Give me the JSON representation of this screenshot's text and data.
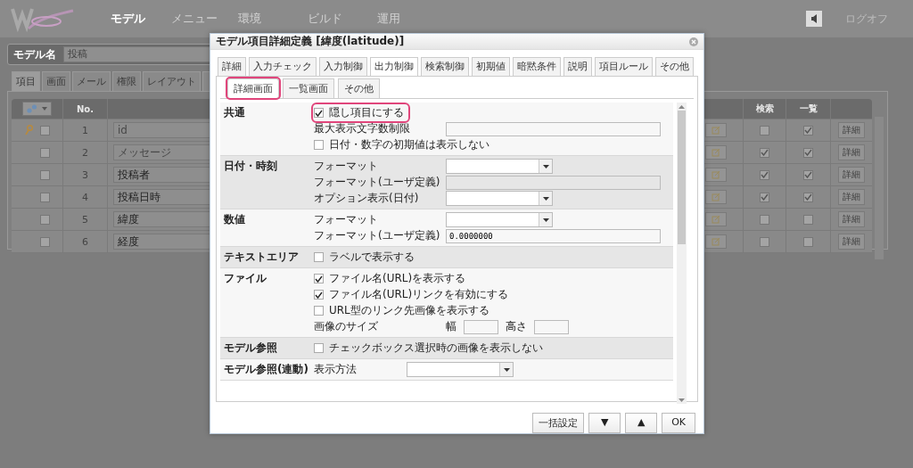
{
  "nav": [
    {
      "label": "モデル",
      "selected": true
    },
    {
      "label": "メニュー",
      "selected": false
    },
    {
      "label": "環境",
      "selected": false
    },
    {
      "label": "ビルド",
      "selected": false
    },
    {
      "label": "運用",
      "selected": false
    }
  ],
  "logoff": "ログオフ",
  "model_name": {
    "label": "モデル名",
    "value": "投稿"
  },
  "page_tabs": [
    {
      "label": "項目",
      "selected": true
    },
    {
      "label": "画面",
      "selected": false
    },
    {
      "label": "メール",
      "selected": false
    },
    {
      "label": "権限",
      "selected": false
    },
    {
      "label": "レイアウト",
      "selected": false
    }
  ],
  "table": {
    "columns": [
      {
        "label": "No."
      },
      {
        "label": "検索"
      },
      {
        "label": "一覧"
      }
    ],
    "rows": [
      {
        "key": true,
        "checked": false,
        "no": "1",
        "name": "id",
        "disabled": true,
        "search": false,
        "list": true,
        "detail": "詳細"
      },
      {
        "key": false,
        "checked": false,
        "no": "2",
        "name": "メッセージ",
        "disabled": true,
        "search": true,
        "list": true,
        "detail": "詳細"
      },
      {
        "key": false,
        "checked": false,
        "no": "3",
        "name": "投稿者",
        "disabled": false,
        "search": true,
        "list": true,
        "detail": "詳細"
      },
      {
        "key": false,
        "checked": false,
        "no": "4",
        "name": "投稿日時",
        "disabled": false,
        "search": true,
        "list": true,
        "detail": "詳細"
      },
      {
        "key": false,
        "checked": false,
        "no": "5",
        "name": "緯度",
        "disabled": false,
        "search": false,
        "list": false,
        "detail": "詳細"
      },
      {
        "key": false,
        "checked": false,
        "no": "6",
        "name": "経度",
        "disabled": false,
        "search": false,
        "list": false,
        "detail": "詳細"
      }
    ]
  },
  "dialog": {
    "title": "モデル項目詳細定義 [緯度(latitude)]",
    "tabs": [
      {
        "label": "詳細",
        "selected": false
      },
      {
        "label": "入力チェック",
        "selected": false
      },
      {
        "label": "入力制御",
        "selected": false
      },
      {
        "label": "出力制御",
        "selected": true
      },
      {
        "label": "検索制御",
        "selected": false
      },
      {
        "label": "初期値",
        "selected": false
      },
      {
        "label": "暗黙条件",
        "selected": false
      },
      {
        "label": "説明",
        "selected": false
      },
      {
        "label": "項目ルール",
        "selected": false
      },
      {
        "label": "その他",
        "selected": false
      }
    ],
    "subtabs": [
      {
        "label": "詳細画面",
        "selected": true,
        "highlighted": true
      },
      {
        "label": "一覧画面",
        "selected": false,
        "highlighted": false
      },
      {
        "label": "その他",
        "selected": false,
        "highlighted": false
      }
    ],
    "sections": [
      {
        "title": "共通",
        "items": [
          {
            "kind": "check",
            "label": "隠し項目にする",
            "checked": true,
            "highlighted": true
          },
          {
            "kind": "text",
            "label": "最大表示文字数制限"
          },
          {
            "kind": "check",
            "label": "日付・数字の初期値は表示しない",
            "checked": false,
            "highlighted": false
          }
        ]
      },
      {
        "title": "日付・時刻",
        "items": [
          {
            "kind": "select",
            "label": "フォーマット"
          },
          {
            "kind": "text",
            "label": "フォーマット(ユーザ定義)"
          },
          {
            "kind": "select",
            "label": "オプション表示(日付)"
          }
        ]
      },
      {
        "title": "数値",
        "items": [
          {
            "kind": "select",
            "label": "フォーマット"
          },
          {
            "kind": "text",
            "label": "フォーマット(ユーザ定義)",
            "value": "0.0000000"
          }
        ]
      },
      {
        "title": "テキストエリア",
        "items": [
          {
            "kind": "check",
            "label": "ラベルで表示する",
            "checked": false,
            "highlighted": false
          }
        ]
      },
      {
        "title": "ファイル",
        "items": [
          {
            "kind": "check",
            "label": "ファイル名(URL)を表示する",
            "checked": true,
            "highlighted": false
          },
          {
            "kind": "check",
            "label": "ファイル名(URL)リンクを有効にする",
            "checked": true,
            "highlighted": false
          },
          {
            "kind": "check",
            "label": "URL型のリンク先画像を表示する",
            "checked": false,
            "highlighted": false
          },
          {
            "kind": "size",
            "label": "画像のサイズ",
            "width_label": "幅",
            "height_label": "高さ"
          }
        ]
      },
      {
        "title": "モデル参照",
        "items": [
          {
            "kind": "check",
            "label": "チェックボックス選択時の画像を表示しない",
            "checked": false,
            "highlighted": false
          }
        ]
      },
      {
        "title": "モデル参照(連動)",
        "items": [
          {
            "kind": "select_near",
            "label": "表示方法"
          }
        ]
      }
    ],
    "buttons": [
      "一括設定",
      "▼",
      "▲",
      "OK"
    ]
  }
}
